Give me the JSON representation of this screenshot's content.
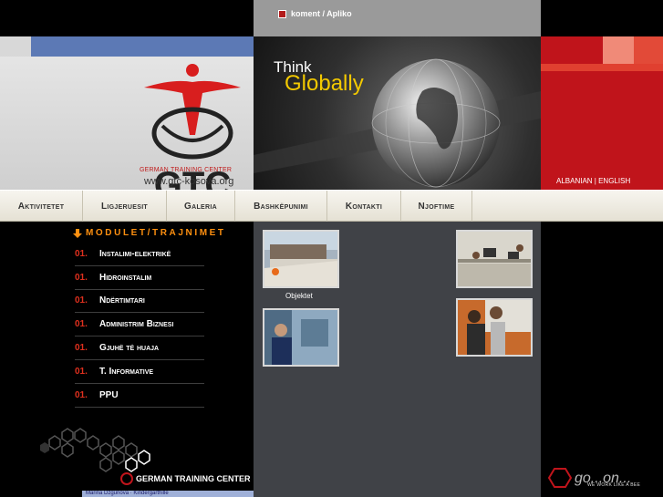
{
  "header": {
    "link_text": "koment / Apliko"
  },
  "banner": {
    "logo_text": "GTC",
    "logo_subtitle": "GERMAN TRAINING CENTER",
    "logo_url": "www.gtc-kosova.org",
    "slogan_line1": "Think",
    "slogan_line2": "Globally",
    "languages": "ALBANIAN | ENGLISH"
  },
  "nav": {
    "items": [
      "Aktivitetet",
      "Ligjeruesit",
      "Galeria",
      "Bashkëpunimi",
      "Kontakti",
      "Njoftime"
    ]
  },
  "sidebar": {
    "title": "MODULET/TRAJNIMET",
    "items": [
      {
        "num": "01.",
        "label": "Instalimi-elektrikë"
      },
      {
        "num": "01.",
        "label": "Hidroinstalim"
      },
      {
        "num": "01.",
        "label": "Ndërtimtari"
      },
      {
        "num": "01.",
        "label": "Administrim Biznesi"
      },
      {
        "num": "01.",
        "label": "Gjuhë të huaja"
      },
      {
        "num": "01.",
        "label": "T. Informative"
      },
      {
        "num": "01.",
        "label": "PPU"
      }
    ],
    "footer_brand": "GERMAN TRAINING CENTER",
    "footer_bar": "Marina Dzgunova · Kindergarthille"
  },
  "gallery": {
    "caption": "Objektet"
  },
  "footer": {
    "goon_text": "go...on...",
    "goon_sub": "WE WORK LIKE A BEE"
  },
  "colors": {
    "accent_red": "#c0141b",
    "orange": "#ff9010",
    "nav_bg": "#efece2",
    "mid_panel": "#404247",
    "blue_stripe": "#5c79b5"
  }
}
